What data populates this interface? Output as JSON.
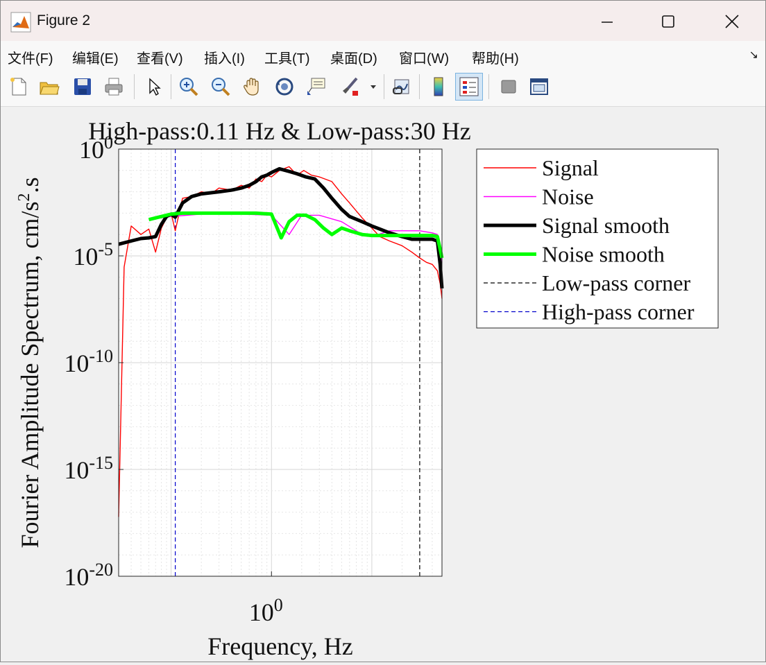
{
  "window": {
    "title": "Figure 2",
    "controls": [
      "minimize",
      "maximize",
      "close"
    ]
  },
  "menu": {
    "items": [
      "文件(F)",
      "编辑(E)",
      "查看(V)",
      "插入(I)",
      "工具(T)",
      "桌面(D)",
      "窗口(W)",
      "帮助(H)"
    ]
  },
  "toolbar": {
    "icons": [
      "new-figure-icon",
      "open-file-icon",
      "save-icon",
      "print-icon",
      "select-arrow-icon",
      "zoom-in-icon",
      "zoom-out-icon",
      "pan-hand-icon",
      "rotate-3d-icon",
      "data-cursor-icon",
      "brush-icon",
      "link-plot-icon",
      "colorbar-icon",
      "legend-icon",
      "hide-tools-icon",
      "dock-icon"
    ]
  },
  "chart_data": {
    "type": "line",
    "title": "High-pass:0.11 Hz & Low-pass:30 Hz",
    "xlabel": "Frequency, Hz",
    "ylabel": "Fourier Amplitude Spectrum, cm/s^2.s",
    "xscale": "log",
    "yscale": "log",
    "xlim": [
      0.03,
      50
    ],
    "ylim": [
      1e-20,
      1
    ],
    "xticks": [
      {
        "value": 1,
        "base": "10",
        "exp": "0"
      }
    ],
    "yticks": [
      {
        "value": 1,
        "base": "10",
        "exp": "0"
      },
      {
        "value": 1e-05,
        "base": "10",
        "exp": "-5"
      },
      {
        "value": 1e-10,
        "base": "10",
        "exp": "-10"
      },
      {
        "value": 1e-15,
        "base": "10",
        "exp": "-15"
      },
      {
        "value": 1e-20,
        "base": "10",
        "exp": "-20"
      }
    ],
    "grid": true,
    "legend_position": "outside-right",
    "series": [
      {
        "name": "Signal",
        "color": "#ff0000",
        "style": "thin",
        "x": [
          0.03,
          0.034,
          0.04,
          0.05,
          0.06,
          0.07,
          0.08,
          0.09,
          0.1,
          0.11,
          0.13,
          0.16,
          0.2,
          0.25,
          0.3,
          0.4,
          0.5,
          0.6,
          0.7,
          0.8,
          0.9,
          1.0,
          1.2,
          1.5,
          1.8,
          2.1,
          2.5,
          3,
          4,
          5,
          6,
          8,
          10,
          12,
          15,
          20,
          25,
          30,
          35,
          40,
          45,
          48,
          50
        ],
        "y": [
          6e-18,
          3e-06,
          0.00025,
          0.0001,
          0.00018,
          1.5e-05,
          0.0002,
          0.0006,
          0.001,
          0.00015,
          0.005,
          0.006,
          0.01,
          0.008,
          0.015,
          0.012,
          0.02,
          0.015,
          0.04,
          0.03,
          0.06,
          0.05,
          0.1,
          0.15,
          0.06,
          0.1,
          0.06,
          0.05,
          0.03,
          0.008,
          0.003,
          0.0006,
          0.0002,
          8e-05,
          5e-05,
          3e-05,
          1.5e-05,
          8e-06,
          5e-06,
          4e-06,
          2e-06,
          5e-07,
          1e-07
        ]
      },
      {
        "name": "Noise",
        "color": "#ff00ff",
        "style": "thin",
        "x": [
          0.06,
          0.08,
          0.1,
          0.2,
          0.5,
          1.0,
          1.5,
          2,
          3,
          5,
          8,
          10,
          15,
          20,
          30,
          40,
          45,
          48,
          50
        ],
        "y": [
          0.0005,
          0.0006,
          0.0007,
          0.0009,
          0.0009,
          0.0008,
          0.0001,
          0.0008,
          0.0008,
          0.0004,
          0.0001,
          8e-05,
          0.00015,
          0.00015,
          0.00015,
          0.00012,
          0.0001,
          2e-05,
          5e-06
        ]
      },
      {
        "name": "Signal smooth",
        "color": "#000000",
        "style": "thick",
        "x": [
          0.03,
          0.04,
          0.05,
          0.06,
          0.07,
          0.08,
          0.09,
          0.1,
          0.11,
          0.13,
          0.16,
          0.2,
          0.3,
          0.4,
          0.5,
          0.6,
          0.7,
          0.8,
          0.9,
          1.0,
          1.2,
          1.5,
          1.8,
          2.2,
          2.7,
          3.3,
          4,
          5,
          6,
          8,
          10,
          12,
          15,
          20,
          25,
          30,
          35,
          40,
          45,
          48,
          50
        ],
        "y": [
          3.5e-05,
          5e-05,
          6.5e-05,
          7e-05,
          8e-05,
          0.0003,
          0.0007,
          0.0009,
          0.00065,
          0.003,
          0.006,
          0.008,
          0.01,
          0.012,
          0.015,
          0.02,
          0.03,
          0.05,
          0.06,
          0.08,
          0.12,
          0.09,
          0.07,
          0.05,
          0.04,
          0.015,
          0.005,
          0.0015,
          0.0007,
          0.0004,
          0.00025,
          0.00018,
          0.00012,
          8e-05,
          6e-05,
          6e-05,
          6e-05,
          6e-05,
          5e-05,
          4e-06,
          3e-07
        ]
      },
      {
        "name": "Noise smooth",
        "color": "#00ff00",
        "style": "thick",
        "x": [
          0.06,
          0.08,
          0.1,
          0.13,
          0.2,
          0.3,
          0.5,
          0.7,
          1.0,
          1.25,
          1.5,
          1.8,
          2.2,
          2.7,
          3.3,
          4,
          5,
          6,
          8,
          10,
          15,
          20,
          25,
          30,
          40,
          45,
          48,
          50
        ],
        "y": [
          0.0005,
          0.0007,
          0.0009,
          0.001,
          0.001,
          0.001,
          0.001,
          0.001,
          0.0009,
          7e-05,
          0.0004,
          0.0008,
          0.0008,
          0.0005,
          0.0002,
          0.0001,
          0.0002,
          0.00015,
          0.0001,
          9e-05,
          9e-05,
          9e-05,
          9e-05,
          9e-05,
          9e-05,
          8e-05,
          2e-05,
          8e-06
        ]
      },
      {
        "name": "Low-pass corner",
        "color": "#000000",
        "style": "dashed-vertical",
        "x": [
          30
        ]
      },
      {
        "name": "High-pass corner",
        "color": "#0000cc",
        "style": "dashed-vertical",
        "x": [
          0.11
        ]
      }
    ]
  }
}
